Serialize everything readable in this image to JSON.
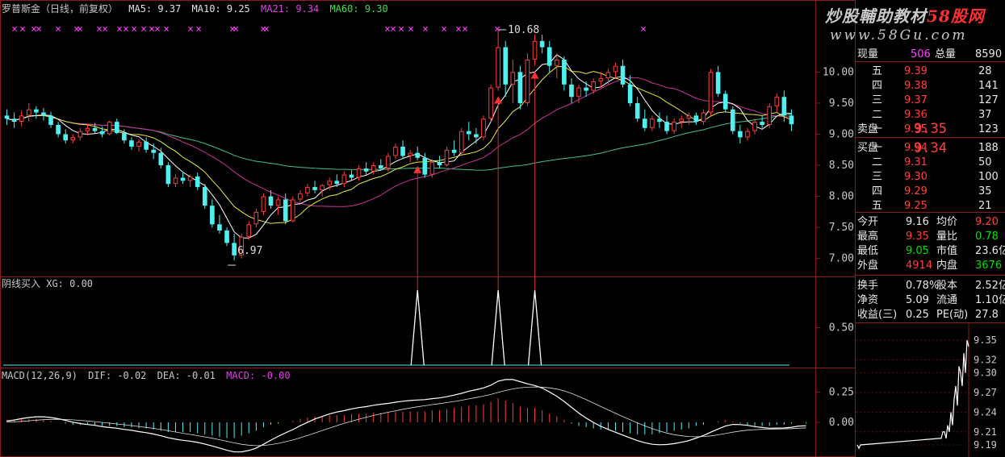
{
  "colors": {
    "up": "#ff3c3c",
    "down": "#50f0f0",
    "ma5": "#ffffff",
    "ma10": "#e8e840",
    "ma21": "#cc3399",
    "ma60": "#40c090",
    "axis": "#8b1a1a",
    "text": "#c8c8c8",
    "mag": "#ff40ff",
    "grn": "#40e040"
  },
  "header": {
    "title": "罗普斯金（日线，前复权）",
    "ma5": "MA5: 9.37",
    "ma10": "MA10: 9.25",
    "ma21": "MA21: 9.34",
    "ma60": "MA60: 9.30"
  },
  "panel2_header": "阴线买入 XG: 0.00",
  "panel3_header": {
    "name": "MACD(12,26,9)",
    "dif": "DIF: -0.02",
    "dea": "DEA: -0.01",
    "macd": "MACD: -0.00"
  },
  "watermark": {
    "line1_a": "炒股輔助教材",
    "line1_b": "58股网",
    "line2": "www.58Gu.com"
  },
  "chart_data": {
    "type": "candlestick",
    "price_axis_ticks": [
      "10.00",
      "9.50",
      "9.00",
      "8.50",
      "8.00",
      "7.50",
      "7.00"
    ],
    "xg_axis_ticks": [
      "0.50"
    ],
    "macd_axis_ticks": [
      "0.25",
      "0.00"
    ],
    "annotations": {
      "high": "10.68",
      "low": "6.97"
    },
    "candles": [
      [
        9.3,
        9.4,
        9.15,
        9.25
      ],
      [
        9.25,
        9.35,
        9.1,
        9.2
      ],
      [
        9.2,
        9.38,
        9.12,
        9.3
      ],
      [
        9.3,
        9.5,
        9.2,
        9.4
      ],
      [
        9.4,
        9.45,
        9.25,
        9.35
      ],
      [
        9.35,
        9.42,
        9.22,
        9.3
      ],
      [
        9.3,
        9.36,
        9.1,
        9.15
      ],
      [
        9.15,
        9.2,
        8.95,
        9.0
      ],
      [
        9.0,
        9.08,
        8.85,
        8.9
      ],
      [
        8.9,
        9.0,
        8.85,
        8.95
      ],
      [
        8.95,
        9.1,
        8.9,
        9.05
      ],
      [
        9.05,
        9.15,
        8.98,
        9.1
      ],
      [
        9.1,
        9.18,
        9.0,
        9.05
      ],
      [
        9.05,
        9.12,
        8.95,
        9.0
      ],
      [
        9.0,
        9.22,
        8.98,
        9.2
      ],
      [
        9.2,
        9.25,
        9.0,
        9.02
      ],
      [
        9.02,
        9.08,
        8.85,
        8.9
      ],
      [
        8.9,
        8.95,
        8.75,
        8.8
      ],
      [
        8.8,
        8.92,
        8.72,
        8.88
      ],
      [
        8.88,
        8.95,
        8.7,
        8.75
      ],
      [
        8.75,
        8.85,
        8.6,
        8.7
      ],
      [
        8.7,
        8.78,
        8.45,
        8.5
      ],
      [
        8.5,
        8.55,
        8.15,
        8.2
      ],
      [
        8.2,
        8.35,
        8.15,
        8.3
      ],
      [
        8.3,
        8.4,
        8.2,
        8.25
      ],
      [
        8.25,
        8.35,
        8.15,
        8.32
      ],
      [
        8.32,
        8.38,
        8.1,
        8.15
      ],
      [
        8.15,
        8.2,
        7.8,
        7.85
      ],
      [
        7.85,
        7.95,
        7.5,
        7.55
      ],
      [
        7.55,
        7.7,
        7.4,
        7.45
      ],
      [
        7.45,
        7.5,
        7.2,
        7.25
      ],
      [
        7.25,
        7.4,
        6.97,
        7.05
      ],
      [
        7.05,
        7.4,
        7.0,
        7.35
      ],
      [
        7.35,
        7.6,
        7.3,
        7.55
      ],
      [
        7.55,
        7.8,
        7.5,
        7.75
      ],
      [
        7.75,
        8.05,
        7.7,
        8.0
      ],
      [
        8.0,
        8.1,
        7.8,
        7.85
      ],
      [
        7.85,
        8.0,
        7.7,
        7.95
      ],
      [
        7.95,
        8.05,
        7.55,
        7.6
      ],
      [
        7.6,
        8.0,
        7.58,
        7.95
      ],
      [
        7.95,
        8.1,
        7.9,
        8.05
      ],
      [
        8.05,
        8.2,
        8.0,
        8.15
      ],
      [
        8.15,
        8.25,
        8.05,
        8.1
      ],
      [
        8.1,
        8.2,
        8.0,
        8.18
      ],
      [
        8.18,
        8.3,
        8.1,
        8.25
      ],
      [
        8.25,
        8.35,
        8.15,
        8.2
      ],
      [
        8.2,
        8.4,
        8.15,
        8.35
      ],
      [
        8.35,
        8.42,
        8.25,
        8.3
      ],
      [
        8.3,
        8.5,
        8.25,
        8.45
      ],
      [
        8.45,
        8.55,
        8.35,
        8.4
      ],
      [
        8.4,
        8.55,
        8.35,
        8.5
      ],
      [
        8.5,
        8.6,
        8.42,
        8.45
      ],
      [
        8.45,
        8.7,
        8.4,
        8.65
      ],
      [
        8.65,
        8.85,
        8.6,
        8.8
      ],
      [
        8.8,
        8.9,
        8.6,
        8.65
      ],
      [
        8.65,
        8.75,
        8.55,
        8.7
      ],
      [
        8.7,
        8.8,
        8.58,
        8.62
      ],
      [
        8.62,
        8.7,
        8.3,
        8.35
      ],
      [
        8.35,
        8.6,
        8.3,
        8.55
      ],
      [
        8.55,
        8.65,
        8.45,
        8.5
      ],
      [
        8.5,
        8.8,
        8.48,
        8.75
      ],
      [
        8.75,
        8.9,
        8.65,
        8.7
      ],
      [
        8.7,
        9.1,
        8.65,
        9.05
      ],
      [
        9.05,
        9.2,
        8.9,
        9.0
      ],
      [
        9.0,
        9.1,
        8.85,
        8.95
      ],
      [
        8.95,
        9.3,
        8.9,
        9.25
      ],
      [
        9.25,
        9.8,
        9.2,
        9.75
      ],
      [
        9.75,
        10.68,
        9.7,
        10.4
      ],
      [
        10.4,
        10.5,
        9.6,
        9.8
      ],
      [
        9.8,
        10.2,
        9.5,
        10.0
      ],
      [
        10.0,
        10.1,
        9.4,
        9.5
      ],
      [
        9.5,
        10.3,
        9.45,
        10.2
      ],
      [
        10.2,
        10.6,
        10.1,
        10.5
      ],
      [
        10.5,
        10.6,
        10.3,
        10.4
      ],
      [
        10.4,
        10.5,
        10.0,
        10.1
      ],
      [
        10.1,
        10.3,
        9.9,
        10.2
      ],
      [
        10.2,
        10.25,
        9.7,
        9.8
      ],
      [
        9.8,
        9.9,
        9.5,
        9.6
      ],
      [
        9.6,
        9.8,
        9.5,
        9.75
      ],
      [
        9.75,
        9.85,
        9.6,
        9.7
      ],
      [
        9.7,
        9.9,
        9.65,
        9.85
      ],
      [
        9.85,
        10.0,
        9.75,
        9.9
      ],
      [
        9.9,
        10.05,
        9.8,
        10.0
      ],
      [
        10.0,
        10.15,
        9.9,
        10.1
      ],
      [
        10.1,
        10.2,
        9.75,
        9.8
      ],
      [
        9.8,
        9.95,
        9.45,
        9.5
      ],
      [
        9.5,
        9.6,
        9.2,
        9.25
      ],
      [
        9.25,
        9.4,
        9.05,
        9.1
      ],
      [
        9.1,
        9.3,
        9.05,
        9.25
      ],
      [
        9.25,
        9.35,
        9.1,
        9.2
      ],
      [
        9.2,
        9.3,
        9.0,
        9.05
      ],
      [
        9.05,
        9.25,
        9.0,
        9.2
      ],
      [
        9.2,
        9.3,
        9.1,
        9.25
      ],
      [
        9.25,
        9.35,
        9.15,
        9.3
      ],
      [
        9.3,
        9.35,
        9.15,
        9.2
      ],
      [
        9.2,
        9.4,
        9.15,
        9.35
      ],
      [
        9.35,
        10.05,
        9.3,
        10.0
      ],
      [
        10.0,
        10.1,
        9.6,
        9.65
      ],
      [
        9.65,
        9.7,
        9.35,
        9.4
      ],
      [
        9.4,
        9.45,
        9.0,
        9.05
      ],
      [
        9.05,
        9.15,
        8.85,
        8.95
      ],
      [
        8.95,
        9.1,
        8.9,
        9.05
      ],
      [
        9.05,
        9.25,
        9.0,
        9.2
      ],
      [
        9.2,
        9.3,
        9.1,
        9.15
      ],
      [
        9.15,
        9.5,
        9.1,
        9.45
      ],
      [
        9.45,
        9.65,
        9.35,
        9.6
      ],
      [
        9.6,
        9.7,
        9.2,
        9.3
      ],
      [
        9.3,
        9.4,
        9.05,
        9.16
      ]
    ],
    "xg_signals": [
      56,
      67,
      72
    ],
    "macd_hist": [
      0.02,
      0.02,
      0.03,
      0.03,
      0.03,
      0.02,
      0.01,
      0.0,
      -0.01,
      -0.02,
      -0.02,
      -0.02,
      -0.02,
      -0.03,
      -0.03,
      -0.03,
      -0.04,
      -0.04,
      -0.05,
      -0.05,
      -0.06,
      -0.07,
      -0.08,
      -0.08,
      -0.08,
      -0.08,
      -0.09,
      -0.1,
      -0.11,
      -0.12,
      -0.13,
      -0.13,
      -0.11,
      -0.09,
      -0.07,
      -0.04,
      -0.02,
      -0.01,
      0.0,
      0.01,
      0.03,
      0.04,
      0.05,
      0.05,
      0.06,
      0.06,
      0.06,
      0.07,
      0.07,
      0.07,
      0.08,
      0.08,
      0.08,
      0.09,
      0.09,
      0.09,
      0.09,
      0.09,
      0.1,
      0.1,
      0.11,
      0.12,
      0.13,
      0.14,
      0.14,
      0.15,
      0.17,
      0.2,
      0.18,
      0.16,
      0.13,
      0.12,
      0.12,
      0.1,
      0.07,
      0.05,
      0.02,
      -0.01,
      -0.03,
      -0.04,
      -0.05,
      -0.06,
      -0.06,
      -0.07,
      -0.08,
      -0.09,
      -0.1,
      -0.1,
      -0.1,
      -0.09,
      -0.08,
      -0.07,
      -0.06,
      -0.05,
      -0.03,
      -0.02,
      0.0,
      0.01,
      0.02,
      0.01,
      -0.01,
      -0.02,
      -0.03,
      -0.03,
      -0.03,
      -0.02,
      -0.02,
      -0.01,
      0.0,
      -0.01
    ]
  },
  "quote": {
    "xianliang_label": "现量",
    "xianliang": "506",
    "zongliang_label": "总量",
    "zongliang": "8590",
    "sell_label": "卖盘",
    "buy_label": "买盘",
    "sell": [
      {
        "lvl": "五",
        "price": "9.39",
        "vol": "28"
      },
      {
        "lvl": "四",
        "price": "9.38",
        "vol": "141"
      },
      {
        "lvl": "三",
        "price": "9.37",
        "vol": "127"
      },
      {
        "lvl": "二",
        "price": "9.36",
        "vol": "37"
      },
      {
        "lvl": "一",
        "price": "9.35",
        "vol": "123"
      }
    ],
    "buy": [
      {
        "lvl": "一",
        "price": "9.34",
        "vol": "188"
      },
      {
        "lvl": "二",
        "price": "9.31",
        "vol": "50"
      },
      {
        "lvl": "三",
        "price": "9.30",
        "vol": "100"
      },
      {
        "lvl": "四",
        "price": "9.29",
        "vol": "35"
      },
      {
        "lvl": "五",
        "price": "9.25",
        "vol": "21"
      }
    ],
    "stats": [
      {
        "l1": "今开",
        "v1": "9.16",
        "l2": "均价",
        "v2": "9.20",
        "c1": "wht",
        "c2": "red"
      },
      {
        "l1": "最高",
        "v1": "9.35",
        "l2": "量比",
        "v2": "0.78",
        "c1": "red",
        "c2": "grn"
      },
      {
        "l1": "最低",
        "v1": "9.05",
        "l2": "市值",
        "v2": "23.6亿",
        "c1": "grn",
        "c2": "wht"
      },
      {
        "l1": "外盘",
        "v1": "4914",
        "l2": "内盘",
        "v2": "3676",
        "c1": "red",
        "c2": "grn"
      }
    ],
    "fin": [
      {
        "l1": "换手",
        "v1": "0.78%",
        "l2": "股本",
        "v2": "2.52亿"
      },
      {
        "l1": "净资",
        "v1": "5.09",
        "l2": "流通",
        "v2": "1.10亿"
      },
      {
        "l1": "收益(三)",
        "v1": "0.25",
        "l2": "PE(动)",
        "v2": "27.8"
      }
    ],
    "mini_ticks": [
      "9.35",
      "9.32",
      "9.30",
      "9.27",
      "9.24",
      "9.21",
      "9.19"
    ],
    "mini_prices": [
      9.19,
      9.185,
      9.19,
      9.2,
      9.2,
      9.21,
      9.21,
      9.2,
      9.22,
      9.21,
      9.24,
      9.22,
      9.26,
      9.28,
      9.25,
      9.31,
      9.3,
      9.28,
      9.33,
      9.3,
      9.35,
      9.34
    ]
  }
}
